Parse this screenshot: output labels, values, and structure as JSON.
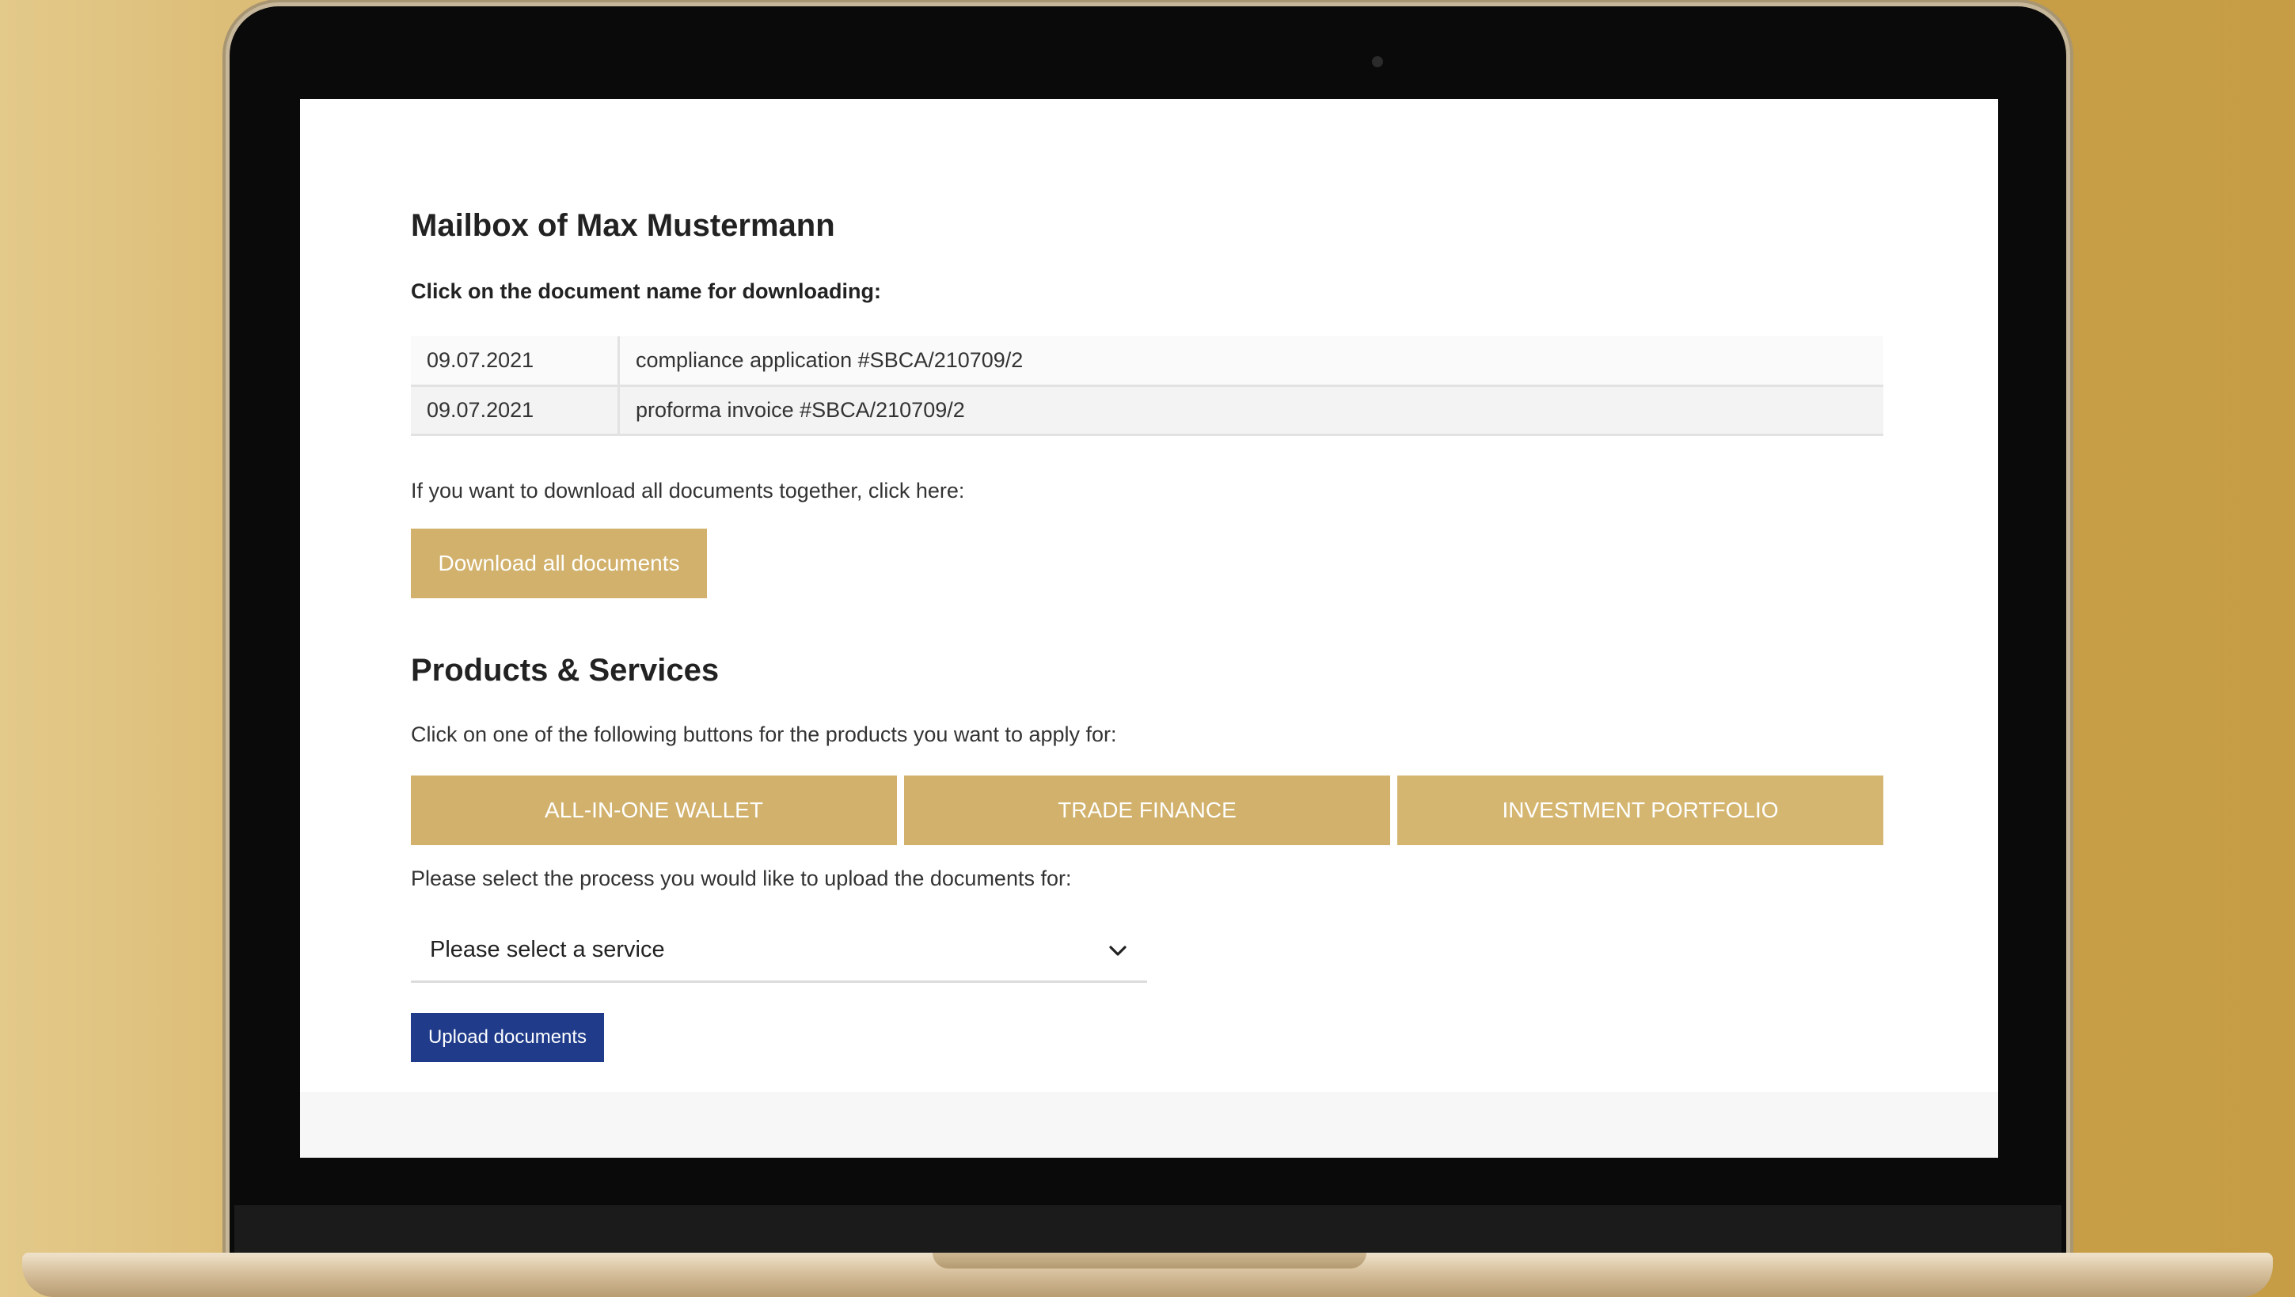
{
  "mailbox": {
    "title": "Mailbox of Max Mustermann",
    "instruction": "Click on the document name for downloading:",
    "documents": [
      {
        "date": "09.07.2021",
        "name": "compliance application #SBCA/210709/2"
      },
      {
        "date": "09.07.2021",
        "name": "proforma invoice #SBCA/210709/2"
      }
    ],
    "download_hint": "If you want to download all documents together, click here:",
    "download_all_label": "Download all documents"
  },
  "products": {
    "title": "Products & Services",
    "hint": "Click on one of the following buttons for the products you want to apply for:",
    "buttons": [
      {
        "label": "ALL-IN-ONE WALLET"
      },
      {
        "label": "TRADE FINANCE"
      },
      {
        "label": "INVESTMENT PORTFOLIO"
      }
    ]
  },
  "upload": {
    "hint": "Please select the process you would like to upload the documents for:",
    "select_value": "Please select a service",
    "button_label": "Upload documents"
  },
  "icons": {
    "dropdown": "chevron-down-icon"
  },
  "colors": {
    "gold_button": "#d1b16b",
    "upload_button": "#1f3b8a",
    "background_gold": "#c9a24a"
  }
}
